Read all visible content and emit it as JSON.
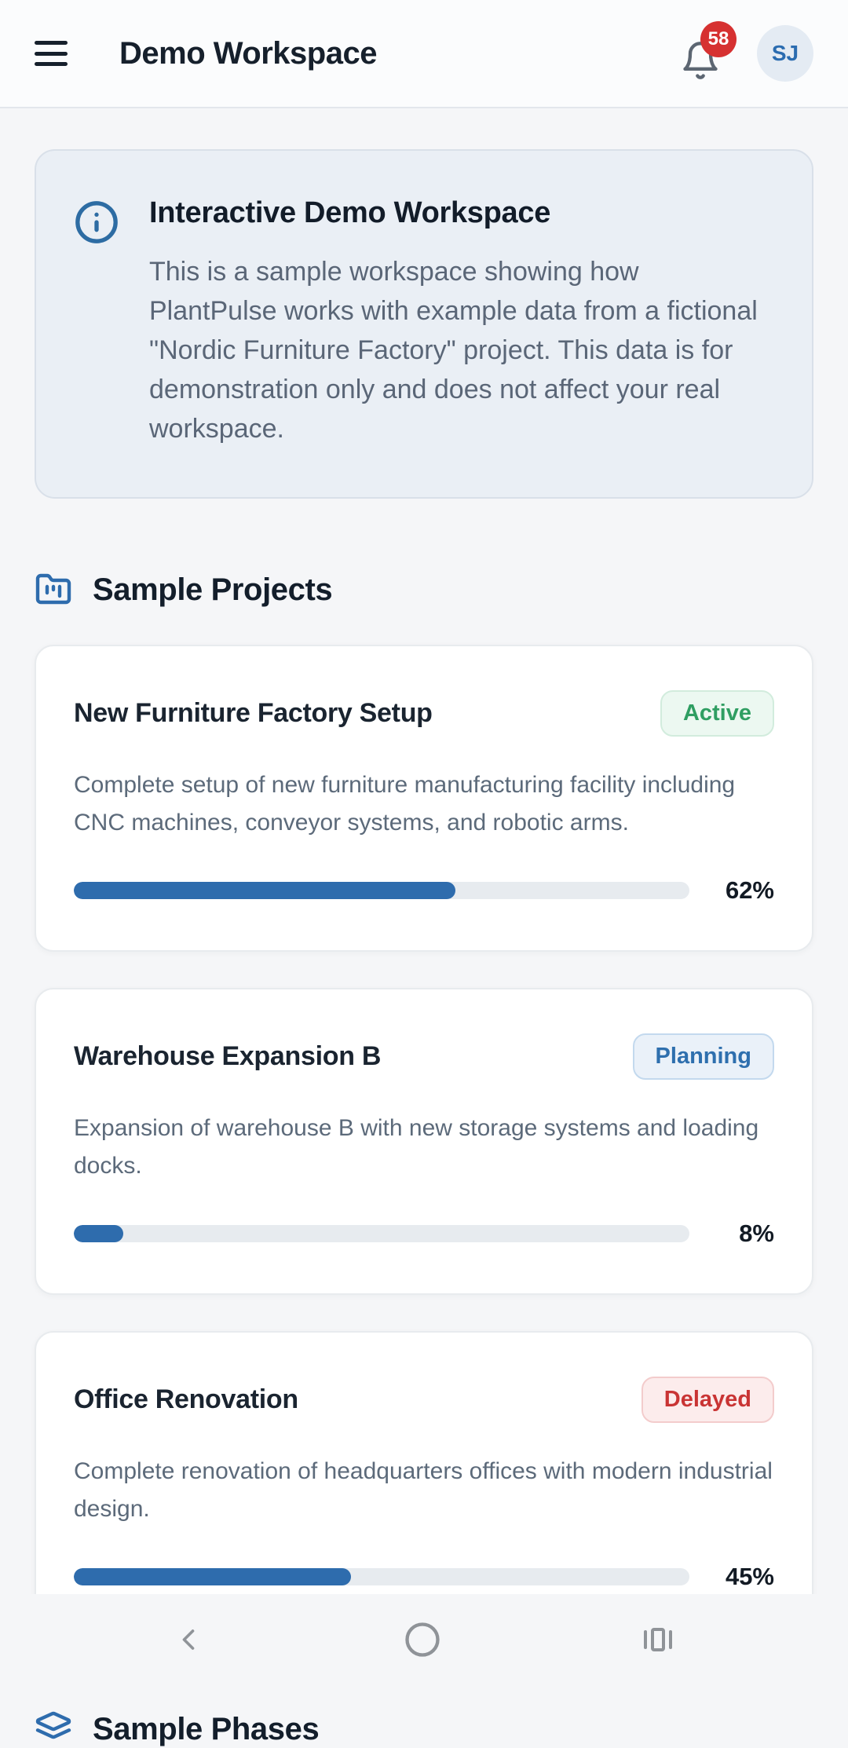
{
  "header": {
    "title": "Demo Workspace",
    "notification_count": "58",
    "avatar_initials": "SJ"
  },
  "info_banner": {
    "title": "Interactive Demo Workspace",
    "body": "This is a sample workspace showing how PlantPulse works with example data from a fictional \"Nordic Furniture Factory\" project. This data is for demonstration only and does not affect your real workspace."
  },
  "sections": {
    "projects": {
      "title": "Sample Projects"
    },
    "phases": {
      "title": "Sample Phases"
    }
  },
  "projects": [
    {
      "name": "New Furniture Factory Setup",
      "status": "Active",
      "description": "Complete setup of new furniture manufacturing facility including CNC machines, conveyor systems, and robotic arms.",
      "progress": 62,
      "progress_label": "62%"
    },
    {
      "name": "Warehouse Expansion B",
      "status": "Planning",
      "description": "Expansion of warehouse B with new storage systems and loading docks.",
      "progress": 8,
      "progress_label": "8%"
    },
    {
      "name": "Office Renovation",
      "status": "Delayed",
      "description": "Complete renovation of headquarters offices with modern industrial design.",
      "progress": 45,
      "progress_label": "45%"
    }
  ],
  "colors": {
    "accent_blue": "#2e6cad",
    "active_green": "#2f9e62",
    "planning_blue": "#2e6fae",
    "delayed_red": "#c93434",
    "notification_red": "#d63131",
    "banner_bg": "#eaeff5",
    "page_bg": "#f5f6f8"
  }
}
